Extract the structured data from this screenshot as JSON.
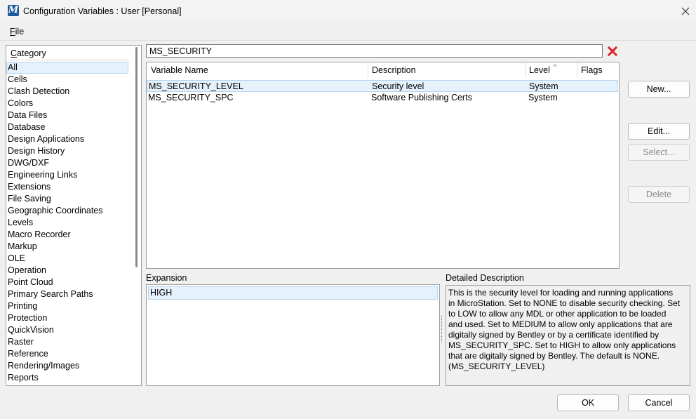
{
  "window": {
    "title": "Configuration Variables : User [Personal]",
    "app_icon": "microstation-icon",
    "app_icon_glyph": "M"
  },
  "menu": {
    "file": "File"
  },
  "category": {
    "header": "Category",
    "items": [
      "All",
      "Cells",
      "Clash Detection",
      "Colors",
      "Data Files",
      "Database",
      "Design Applications",
      "Design History",
      "DWG/DXF",
      "Engineering Links",
      "Extensions",
      "File Saving",
      "Geographic Coordinates",
      "Levels",
      "Macro Recorder",
      "Markup",
      "OLE",
      "Operation",
      "Point Cloud",
      "Primary Search Paths",
      "Printing",
      "Protection",
      "QuickVision",
      "Raster",
      "Reference",
      "Rendering/Images",
      "Reports"
    ],
    "selected": "All"
  },
  "search": {
    "value": "MS_SECURITY"
  },
  "table": {
    "columns": {
      "name": "Variable Name",
      "description": "Description",
      "level": "Level",
      "flags": "Flags"
    },
    "sort_indicator": "^",
    "rows": [
      {
        "name": "MS_SECURITY_LEVEL",
        "description": "Security level",
        "level": "System",
        "flags": ""
      },
      {
        "name": "MS_SECURITY_SPC",
        "description": "Software Publishing Certs",
        "level": "System",
        "flags": ""
      }
    ]
  },
  "buttons": {
    "new": "New...",
    "edit": "Edit...",
    "select": "Select...",
    "delete": "Delete",
    "ok": "OK",
    "cancel": "Cancel"
  },
  "expansion": {
    "label": "Expansion",
    "value": "HIGH"
  },
  "detail": {
    "label": "Detailed Description",
    "text": "This is the security level for loading and running applications\nin MicroStation. Set to NONE to disable security checking. Set\nto LOW to allow any MDL or other application to be loaded\nand used. Set to MEDIUM to allow only applications that are\ndigitally signed by Bentley or by a certificate identified by\nMS_SECURITY_SPC. Set to HIGH to allow only applications\nthat are digitally signed by Bentley. The default is NONE.\n(MS_SECURITY_LEVEL)"
  },
  "colors": {
    "selection_bg": "#e5f1fb",
    "selection_border": "#b6d3ef",
    "clear_icon": "#d9262a",
    "app_icon_bg": "#1c5a9c"
  }
}
